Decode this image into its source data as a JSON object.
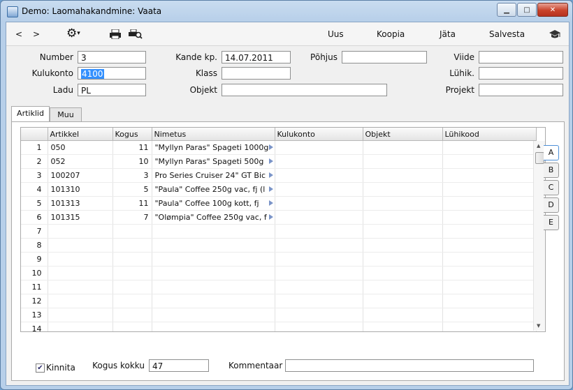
{
  "window": {
    "title": "Demo: Laomahakandmine: Vaata"
  },
  "toolbar": {
    "back": "<",
    "forward": ">",
    "new": "Uus",
    "copy": "Koopia",
    "skip": "Jäta",
    "save": "Salvesta"
  },
  "form": {
    "number": {
      "label": "Number",
      "value": "3"
    },
    "kulukonto": {
      "label": "Kulukonto",
      "value": "4100"
    },
    "ladu": {
      "label": "Ladu",
      "value": "PL"
    },
    "kande_kp": {
      "label": "Kande kp.",
      "value": "14.07.2011"
    },
    "klass": {
      "label": "Klass",
      "value": ""
    },
    "objekt": {
      "label": "Objekt",
      "value": ""
    },
    "pohjus": {
      "label": "Põhjus",
      "value": ""
    },
    "viide": {
      "label": "Viide",
      "value": ""
    },
    "luhik": {
      "label": "Lühik.",
      "value": ""
    },
    "projekt": {
      "label": "Projekt",
      "value": ""
    }
  },
  "tabs": [
    "Artiklid",
    "Muu"
  ],
  "grid": {
    "columns": [
      "",
      "Artikkel",
      "Kogus",
      "Nimetus",
      "Kulukonto",
      "Objekt",
      "Lühikood"
    ],
    "rows": [
      [
        "1",
        "050",
        "11",
        "\"Myllyn Paras\" Spageti 1000g"
      ],
      [
        "2",
        "052",
        "10",
        "\"Myllyn Paras\" Spageti 500g"
      ],
      [
        "3",
        "100207",
        "3",
        "Pro Series Cruiser 24\"  GT Bic"
      ],
      [
        "4",
        "101310",
        "5",
        "\"Paula\" Coffee 250g vac, fj (l"
      ],
      [
        "5",
        "101313",
        "11",
        "\"Paula\" Coffee 100g kott, fj"
      ],
      [
        "6",
        "101315",
        "7",
        "\"Olømpia\" Coffee 250g vac, f"
      ],
      [
        "7",
        "",
        "",
        ""
      ],
      [
        "8",
        "",
        "",
        ""
      ],
      [
        "9",
        "",
        "",
        ""
      ],
      [
        "10",
        "",
        "",
        ""
      ],
      [
        "11",
        "",
        "",
        ""
      ],
      [
        "12",
        "",
        "",
        ""
      ],
      [
        "13",
        "",
        "",
        ""
      ],
      [
        "14",
        "",
        "",
        ""
      ]
    ]
  },
  "side_tabs": [
    "A",
    "B",
    "C",
    "D",
    "E"
  ],
  "footer": {
    "kinnita_label": "Kinnita",
    "kinnita_checked": true,
    "kogus_kokku_label": "Kogus kokku",
    "kogus_kokku_value": "47",
    "kommentaar_label": "Kommentaar",
    "kommentaar_value": ""
  }
}
